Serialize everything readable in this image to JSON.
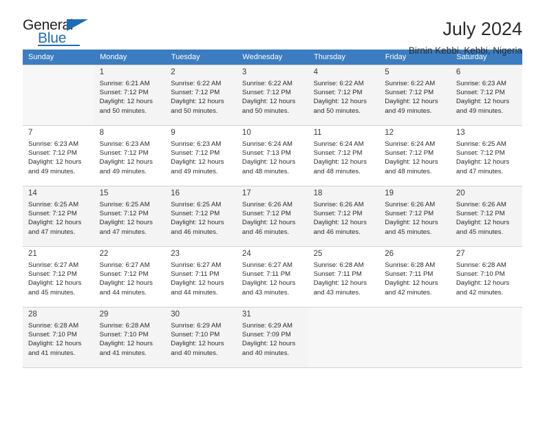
{
  "brand": {
    "name_part1": "General",
    "name_part2": "Blue",
    "accent_color": "#1d6cb5"
  },
  "header": {
    "title": "July 2024",
    "subtitle": "Birnin Kebbi, Kebbi, Nigeria"
  },
  "calendar": {
    "header_bg": "#3b7dc0",
    "weekdays": [
      "Sunday",
      "Monday",
      "Tuesday",
      "Wednesday",
      "Thursday",
      "Friday",
      "Saturday"
    ],
    "weeks": [
      [
        {
          "day": "",
          "sunrise": "",
          "sunset": "",
          "daylight1": "",
          "daylight2": ""
        },
        {
          "day": "1",
          "sunrise": "Sunrise: 6:21 AM",
          "sunset": "Sunset: 7:12 PM",
          "daylight1": "Daylight: 12 hours",
          "daylight2": "and 50 minutes."
        },
        {
          "day": "2",
          "sunrise": "Sunrise: 6:22 AM",
          "sunset": "Sunset: 7:12 PM",
          "daylight1": "Daylight: 12 hours",
          "daylight2": "and 50 minutes."
        },
        {
          "day": "3",
          "sunrise": "Sunrise: 6:22 AM",
          "sunset": "Sunset: 7:12 PM",
          "daylight1": "Daylight: 12 hours",
          "daylight2": "and 50 minutes."
        },
        {
          "day": "4",
          "sunrise": "Sunrise: 6:22 AM",
          "sunset": "Sunset: 7:12 PM",
          "daylight1": "Daylight: 12 hours",
          "daylight2": "and 50 minutes."
        },
        {
          "day": "5",
          "sunrise": "Sunrise: 6:22 AM",
          "sunset": "Sunset: 7:12 PM",
          "daylight1": "Daylight: 12 hours",
          "daylight2": "and 49 minutes."
        },
        {
          "day": "6",
          "sunrise": "Sunrise: 6:23 AM",
          "sunset": "Sunset: 7:12 PM",
          "daylight1": "Daylight: 12 hours",
          "daylight2": "and 49 minutes."
        }
      ],
      [
        {
          "day": "7",
          "sunrise": "Sunrise: 6:23 AM",
          "sunset": "Sunset: 7:12 PM",
          "daylight1": "Daylight: 12 hours",
          "daylight2": "and 49 minutes."
        },
        {
          "day": "8",
          "sunrise": "Sunrise: 6:23 AM",
          "sunset": "Sunset: 7:12 PM",
          "daylight1": "Daylight: 12 hours",
          "daylight2": "and 49 minutes."
        },
        {
          "day": "9",
          "sunrise": "Sunrise: 6:23 AM",
          "sunset": "Sunset: 7:12 PM",
          "daylight1": "Daylight: 12 hours",
          "daylight2": "and 49 minutes."
        },
        {
          "day": "10",
          "sunrise": "Sunrise: 6:24 AM",
          "sunset": "Sunset: 7:13 PM",
          "daylight1": "Daylight: 12 hours",
          "daylight2": "and 48 minutes."
        },
        {
          "day": "11",
          "sunrise": "Sunrise: 6:24 AM",
          "sunset": "Sunset: 7:12 PM",
          "daylight1": "Daylight: 12 hours",
          "daylight2": "and 48 minutes."
        },
        {
          "day": "12",
          "sunrise": "Sunrise: 6:24 AM",
          "sunset": "Sunset: 7:12 PM",
          "daylight1": "Daylight: 12 hours",
          "daylight2": "and 48 minutes."
        },
        {
          "day": "13",
          "sunrise": "Sunrise: 6:25 AM",
          "sunset": "Sunset: 7:12 PM",
          "daylight1": "Daylight: 12 hours",
          "daylight2": "and 47 minutes."
        }
      ],
      [
        {
          "day": "14",
          "sunrise": "Sunrise: 6:25 AM",
          "sunset": "Sunset: 7:12 PM",
          "daylight1": "Daylight: 12 hours",
          "daylight2": "and 47 minutes."
        },
        {
          "day": "15",
          "sunrise": "Sunrise: 6:25 AM",
          "sunset": "Sunset: 7:12 PM",
          "daylight1": "Daylight: 12 hours",
          "daylight2": "and 47 minutes."
        },
        {
          "day": "16",
          "sunrise": "Sunrise: 6:25 AM",
          "sunset": "Sunset: 7:12 PM",
          "daylight1": "Daylight: 12 hours",
          "daylight2": "and 46 minutes."
        },
        {
          "day": "17",
          "sunrise": "Sunrise: 6:26 AM",
          "sunset": "Sunset: 7:12 PM",
          "daylight1": "Daylight: 12 hours",
          "daylight2": "and 46 minutes."
        },
        {
          "day": "18",
          "sunrise": "Sunrise: 6:26 AM",
          "sunset": "Sunset: 7:12 PM",
          "daylight1": "Daylight: 12 hours",
          "daylight2": "and 46 minutes."
        },
        {
          "day": "19",
          "sunrise": "Sunrise: 6:26 AM",
          "sunset": "Sunset: 7:12 PM",
          "daylight1": "Daylight: 12 hours",
          "daylight2": "and 45 minutes."
        },
        {
          "day": "20",
          "sunrise": "Sunrise: 6:26 AM",
          "sunset": "Sunset: 7:12 PM",
          "daylight1": "Daylight: 12 hours",
          "daylight2": "and 45 minutes."
        }
      ],
      [
        {
          "day": "21",
          "sunrise": "Sunrise: 6:27 AM",
          "sunset": "Sunset: 7:12 PM",
          "daylight1": "Daylight: 12 hours",
          "daylight2": "and 45 minutes."
        },
        {
          "day": "22",
          "sunrise": "Sunrise: 6:27 AM",
          "sunset": "Sunset: 7:12 PM",
          "daylight1": "Daylight: 12 hours",
          "daylight2": "and 44 minutes."
        },
        {
          "day": "23",
          "sunrise": "Sunrise: 6:27 AM",
          "sunset": "Sunset: 7:11 PM",
          "daylight1": "Daylight: 12 hours",
          "daylight2": "and 44 minutes."
        },
        {
          "day": "24",
          "sunrise": "Sunrise: 6:27 AM",
          "sunset": "Sunset: 7:11 PM",
          "daylight1": "Daylight: 12 hours",
          "daylight2": "and 43 minutes."
        },
        {
          "day": "25",
          "sunrise": "Sunrise: 6:28 AM",
          "sunset": "Sunset: 7:11 PM",
          "daylight1": "Daylight: 12 hours",
          "daylight2": "and 43 minutes."
        },
        {
          "day": "26",
          "sunrise": "Sunrise: 6:28 AM",
          "sunset": "Sunset: 7:11 PM",
          "daylight1": "Daylight: 12 hours",
          "daylight2": "and 42 minutes."
        },
        {
          "day": "27",
          "sunrise": "Sunrise: 6:28 AM",
          "sunset": "Sunset: 7:10 PM",
          "daylight1": "Daylight: 12 hours",
          "daylight2": "and 42 minutes."
        }
      ],
      [
        {
          "day": "28",
          "sunrise": "Sunrise: 6:28 AM",
          "sunset": "Sunset: 7:10 PM",
          "daylight1": "Daylight: 12 hours",
          "daylight2": "and 41 minutes."
        },
        {
          "day": "29",
          "sunrise": "Sunrise: 6:28 AM",
          "sunset": "Sunset: 7:10 PM",
          "daylight1": "Daylight: 12 hours",
          "daylight2": "and 41 minutes."
        },
        {
          "day": "30",
          "sunrise": "Sunrise: 6:29 AM",
          "sunset": "Sunset: 7:10 PM",
          "daylight1": "Daylight: 12 hours",
          "daylight2": "and 40 minutes."
        },
        {
          "day": "31",
          "sunrise": "Sunrise: 6:29 AM",
          "sunset": "Sunset: 7:09 PM",
          "daylight1": "Daylight: 12 hours",
          "daylight2": "and 40 minutes."
        },
        {
          "day": "",
          "sunrise": "",
          "sunset": "",
          "daylight1": "",
          "daylight2": ""
        },
        {
          "day": "",
          "sunrise": "",
          "sunset": "",
          "daylight1": "",
          "daylight2": ""
        },
        {
          "day": "",
          "sunrise": "",
          "sunset": "",
          "daylight1": "",
          "daylight2": ""
        }
      ]
    ]
  }
}
